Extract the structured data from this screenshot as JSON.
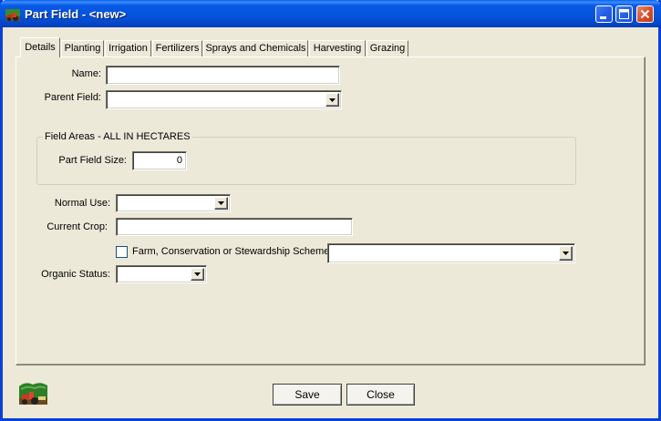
{
  "window": {
    "title": "Part Field - <new>"
  },
  "tabs": [
    {
      "label": "Details",
      "active": true
    },
    {
      "label": "Planting",
      "active": false
    },
    {
      "label": "Irrigation",
      "active": false
    },
    {
      "label": "Fertilizers",
      "active": false
    },
    {
      "label": "Sprays and Chemicals",
      "active": false
    },
    {
      "label": "Harvesting",
      "active": false
    },
    {
      "label": "Grazing",
      "active": false
    }
  ],
  "form": {
    "name_label": "Name:",
    "name_value": "",
    "parent_field_label": "Parent Field:",
    "parent_field_value": "",
    "field_areas_title": "Field Areas - ALL IN HECTARES",
    "part_field_size_label": "Part Field Size:",
    "part_field_size_value": "0",
    "normal_use_label": "Normal Use:",
    "normal_use_value": "",
    "current_crop_label": "Current Crop:",
    "current_crop_value": "",
    "scheme_label": "Farm, Conservation or Stewardship Scheme",
    "scheme_checked": false,
    "scheme_value": "",
    "organic_status_label": "Organic Status:",
    "organic_status_value": ""
  },
  "buttons": {
    "save_label": "Save",
    "close_label": "Close"
  },
  "icons": {
    "app": "tractor-field-icon",
    "minimize": "minimize-icon",
    "maximize": "maximize-icon",
    "close": "close-icon",
    "logo": "farm-logo-icon",
    "dropdown": "chevron-down-icon"
  }
}
